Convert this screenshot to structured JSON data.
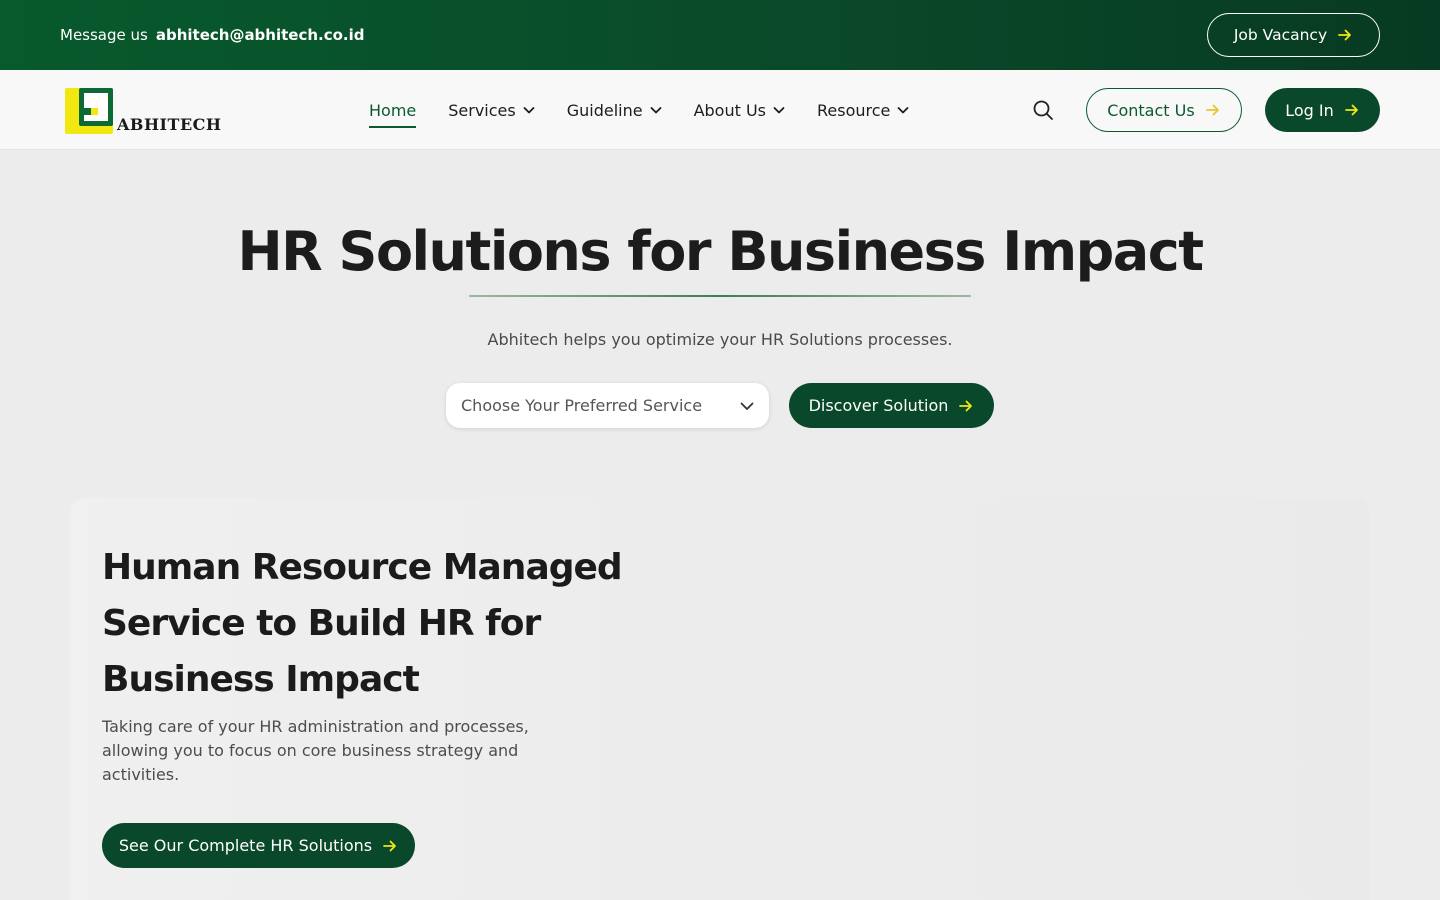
{
  "topbar": {
    "message_label": "Message us",
    "email": "abhitech@abhitech.co.id",
    "job_vacancy_label": "Job Vacancy"
  },
  "brand": {
    "logo_text": "ABHITECH",
    "colors": {
      "primary": "#09482a",
      "accent": "#f2e711",
      "topbar": "#075a2c"
    }
  },
  "nav": {
    "items": [
      {
        "label": "Home",
        "active": true
      },
      {
        "label": "Services",
        "dropdown": true
      },
      {
        "label": "Guideline",
        "dropdown": true
      },
      {
        "label": "About Us",
        "dropdown": true
      },
      {
        "label": "Resource",
        "dropdown": true
      }
    ],
    "search_icon": "search-icon",
    "contact_label": "Contact Us",
    "login_label": "Log In"
  },
  "hero": {
    "title": "HR Solutions for Business Impact",
    "subtitle": "Abhitech helps you optimize your HR Solutions processes.",
    "select_placeholder": "Choose Your Preferred Service",
    "discover_label": "Discover Solution"
  },
  "feature": {
    "title": "Human Resource Managed Service to Build HR for Business Impact",
    "description": "Taking care of your HR administration and processes, allowing you to focus on core business strategy and activities.",
    "cta_label": "See Our Complete HR Solutions"
  }
}
